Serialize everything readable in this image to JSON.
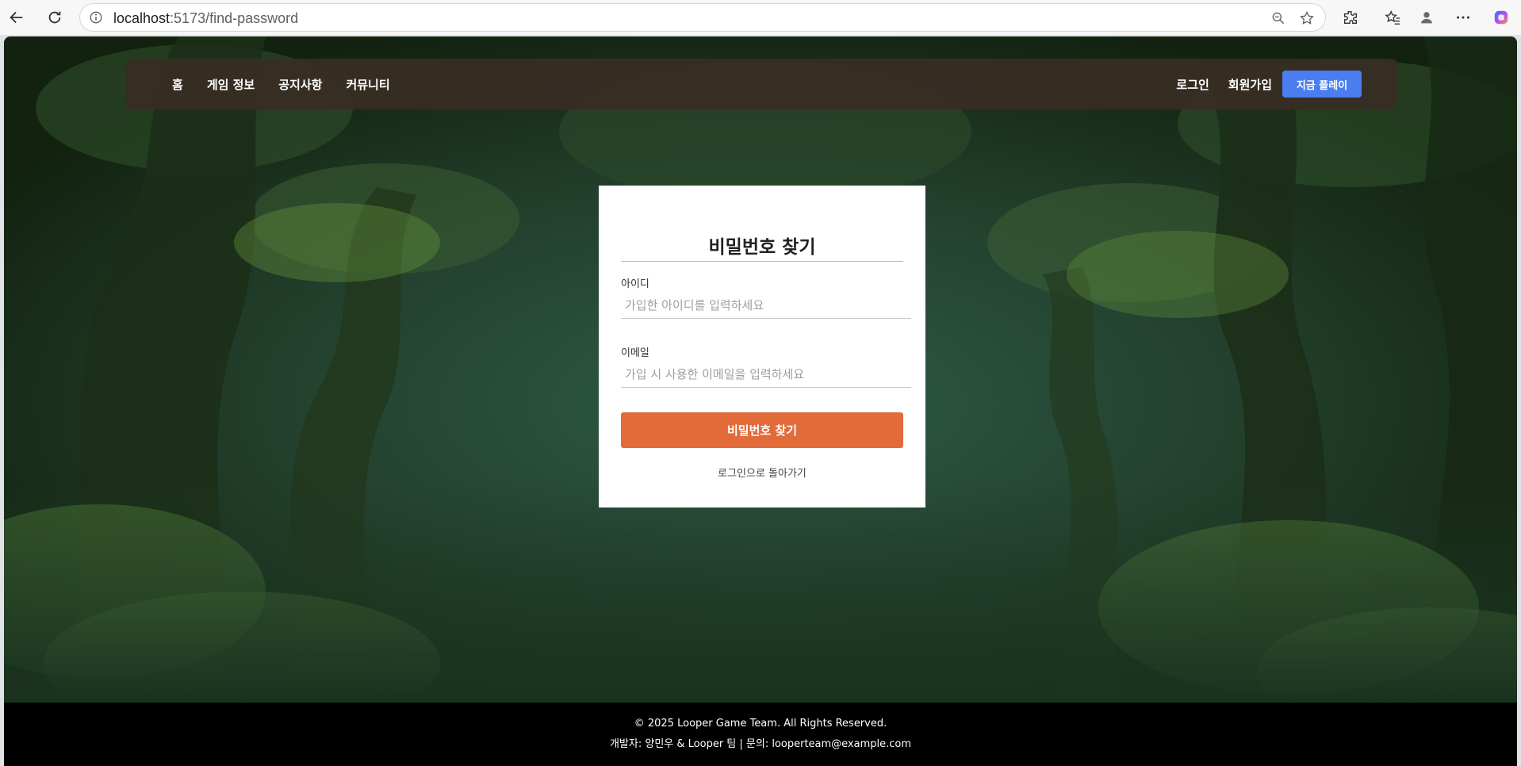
{
  "browser": {
    "url_host": "localhost",
    "url_path": ":5173/find-password",
    "icons": [
      "back-arrow-icon",
      "reload-icon",
      "site-info-icon",
      "zoom-out-icon",
      "star-icon",
      "extensions-icon",
      "favorites-icon",
      "profile-icon",
      "more-icon",
      "copilot-icon"
    ]
  },
  "nav": {
    "items": [
      {
        "label": "홈"
      },
      {
        "label": "게임 정보"
      },
      {
        "label": "공지사항"
      },
      {
        "label": "커뮤니티"
      }
    ],
    "login_label": "로그인",
    "signup_label": "회원가입",
    "play_label": "지금 플레이"
  },
  "card": {
    "title": "비밀번호 찾기",
    "id_label": "아이디",
    "id_placeholder": "가입한 아이디를 입력하세요",
    "email_label": "이메일",
    "email_placeholder": "가입 시 사용한 이메일을 입력하세요",
    "submit_label": "비밀번호 찾기",
    "back_link": "로그인으로 돌아가기"
  },
  "footer": {
    "copyright": "© 2025 Looper Game Team. All Rights Reserved.",
    "contact": "개발자: 양민우 & Looper 팀 | 문의: looperteam@example.com"
  },
  "colors": {
    "accent_orange": "#e36b3a",
    "play_blue": "#4a7ef0",
    "nav_bg": "#382d24",
    "footer_bg": "#000000"
  }
}
